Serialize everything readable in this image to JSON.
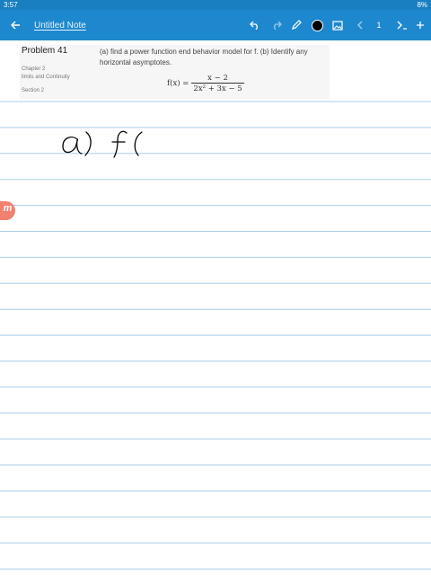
{
  "status": {
    "time": "3:57",
    "battery": "8%"
  },
  "toolbar": {
    "note_title": "Untitled Note",
    "page_number": "1"
  },
  "problem": {
    "title": "Problem 41",
    "chapter_label": "Chapter 2",
    "chapter_name": "limits and Continuity",
    "section_label": "Section 2",
    "text": "(a) find a power function end behavior model for f. (b) Identify any horizontal asymptotes.",
    "formula_lhs": "f(x) =",
    "formula_numerator": "x − 2",
    "formula_denominator": "2x² + 3x − 5"
  },
  "badge": {
    "letter": "m"
  },
  "colors": {
    "accent": "#1e88cf",
    "statusbar": "#1a7fc1",
    "rule_line": "#a9cdeb",
    "badge": "#f08070",
    "ink": "#000000"
  },
  "icons": [
    "back-arrow-icon",
    "undo-icon",
    "redo-icon",
    "pen-icon",
    "color-picker-icon",
    "image-icon",
    "chevron-left-icon",
    "chevron-right-icon",
    "more-icon"
  ]
}
